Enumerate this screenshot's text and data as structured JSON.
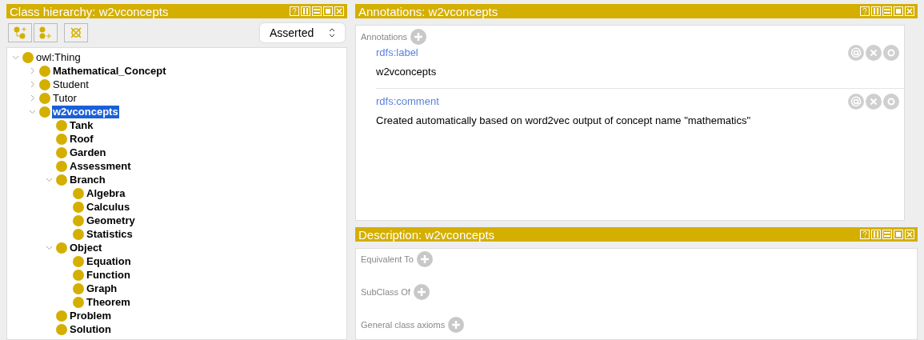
{
  "hierarchy": {
    "title": "Class hierarchy: w2vconcepts",
    "mode": "Asserted",
    "tree": [
      {
        "label": "owl:Thing",
        "bold": false,
        "selected": false,
        "expanded": true,
        "children": [
          {
            "label": "Mathematical_Concept",
            "bold": true,
            "selected": false,
            "expanded": false
          },
          {
            "label": "Student",
            "bold": false,
            "selected": false,
            "expanded": false
          },
          {
            "label": "Tutor",
            "bold": false,
            "selected": false,
            "expanded": false
          },
          {
            "label": "w2vconcepts",
            "bold": true,
            "selected": true,
            "expanded": true,
            "children": [
              {
                "label": "Tank",
                "bold": true,
                "selected": false
              },
              {
                "label": "Roof",
                "bold": true,
                "selected": false
              },
              {
                "label": "Garden",
                "bold": true,
                "selected": false
              },
              {
                "label": "Assessment",
                "bold": true,
                "selected": false
              },
              {
                "label": "Branch",
                "bold": true,
                "selected": false,
                "expanded": true,
                "children": [
                  {
                    "label": "Algebra",
                    "bold": true,
                    "selected": false
                  },
                  {
                    "label": "Calculus",
                    "bold": true,
                    "selected": false
                  },
                  {
                    "label": "Geometry",
                    "bold": true,
                    "selected": false
                  },
                  {
                    "label": "Statistics",
                    "bold": true,
                    "selected": false
                  }
                ]
              },
              {
                "label": "Object",
                "bold": true,
                "selected": false,
                "expanded": true,
                "children": [
                  {
                    "label": "Equation",
                    "bold": true,
                    "selected": false
                  },
                  {
                    "label": "Function",
                    "bold": true,
                    "selected": false
                  },
                  {
                    "label": "Graph",
                    "bold": true,
                    "selected": false
                  },
                  {
                    "label": "Theorem",
                    "bold": true,
                    "selected": false
                  }
                ]
              },
              {
                "label": "Problem",
                "bold": true,
                "selected": false
              },
              {
                "label": "Solution",
                "bold": true,
                "selected": false
              }
            ]
          }
        ]
      }
    ]
  },
  "annotations": {
    "title": "Annotations: w2vconcepts",
    "section": "Annotations",
    "items": [
      {
        "property": "rdfs:label",
        "value": "w2vconcepts"
      },
      {
        "property": "rdfs:comment",
        "value": "Created automatically based on word2vec output of concept name \"mathematics\""
      }
    ]
  },
  "description": {
    "title": "Description: w2vconcepts",
    "sections": [
      "Equivalent To",
      "SubClass Of",
      "General class axioms"
    ]
  }
}
